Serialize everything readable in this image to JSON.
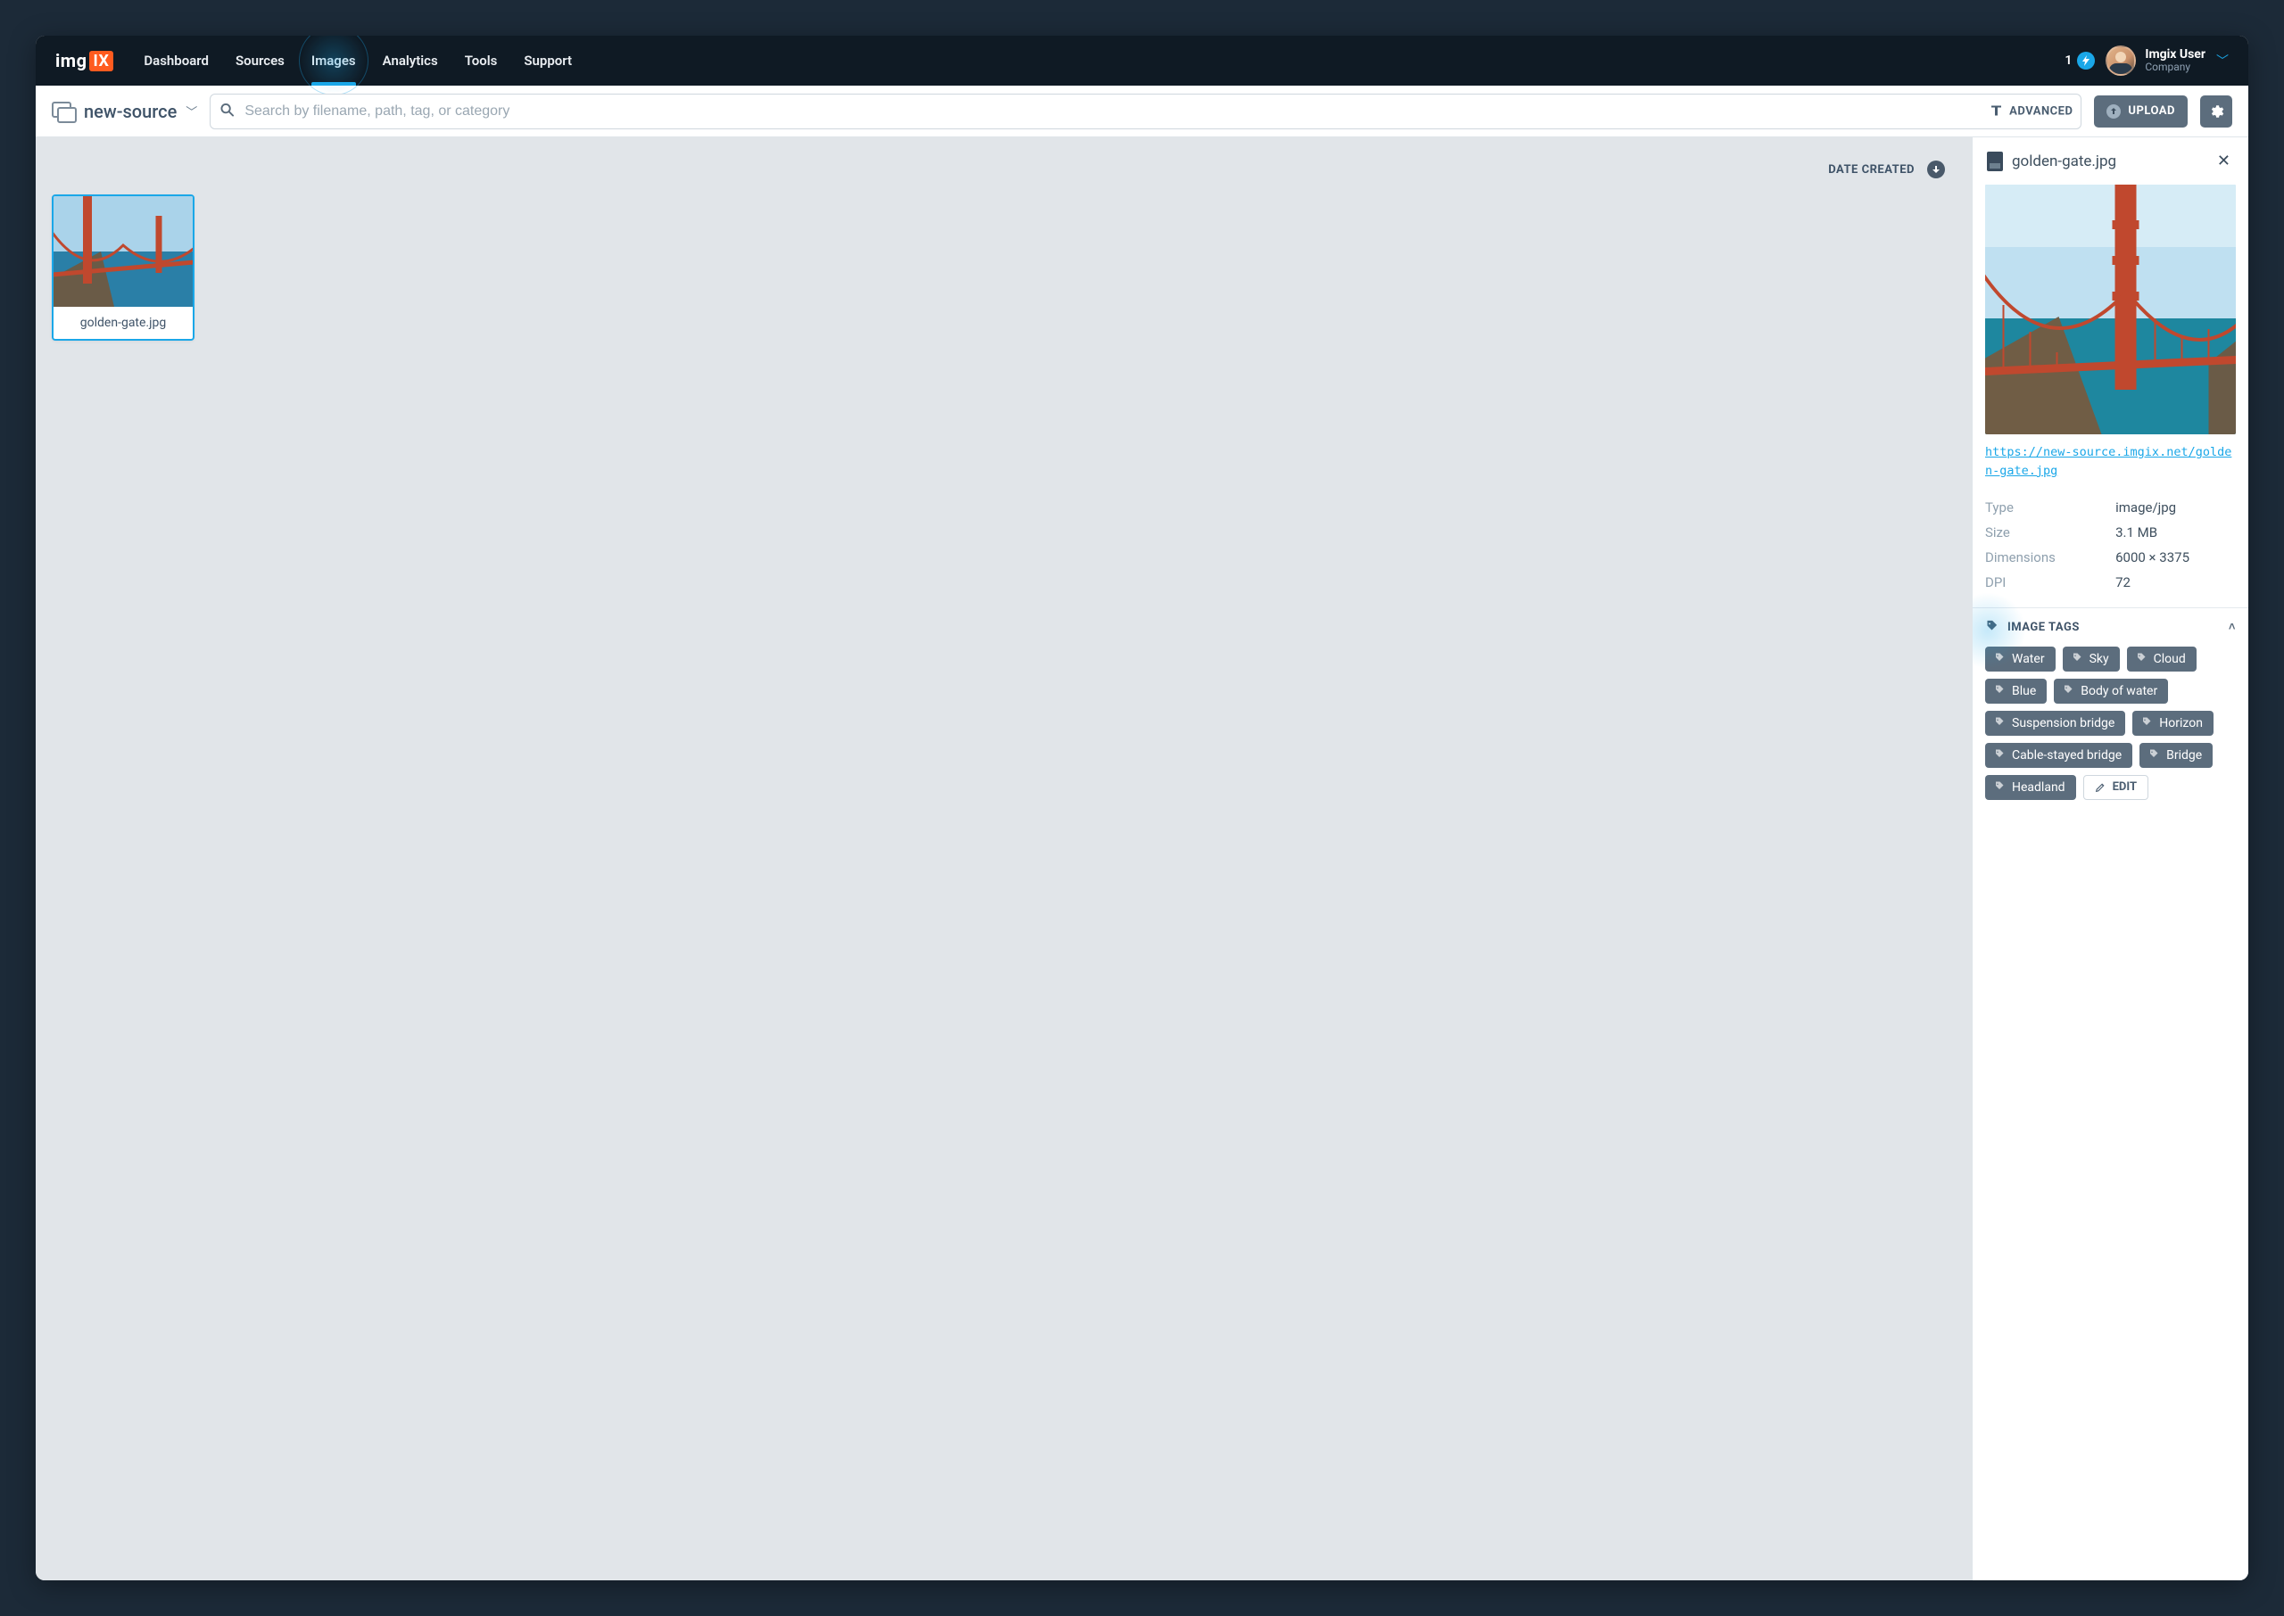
{
  "brand": {
    "logo_text": "img",
    "logo_box": "IX"
  },
  "nav": {
    "items": [
      {
        "label": "Dashboard",
        "active": false
      },
      {
        "label": "Sources",
        "active": false
      },
      {
        "label": "Images",
        "active": true
      },
      {
        "label": "Analytics",
        "active": false
      },
      {
        "label": "Tools",
        "active": false
      },
      {
        "label": "Support",
        "active": false
      }
    ]
  },
  "notifications": {
    "count": "1"
  },
  "user": {
    "name": "Imgix User",
    "company": "Company"
  },
  "source_selector": {
    "name": "new-source"
  },
  "search": {
    "placeholder": "Search by filename, path, tag, or category",
    "advanced_label": "ADVANCED"
  },
  "toolbar": {
    "upload_label": "UPLOAD"
  },
  "grid": {
    "sort_label": "DATE CREATED",
    "items": [
      {
        "filename": "golden-gate.jpg"
      }
    ]
  },
  "details": {
    "filename": "golden-gate.jpg",
    "url": "https://new-source.imgix.net/golden-gate.jpg",
    "meta": [
      {
        "k": "Type",
        "v": "image/jpg"
      },
      {
        "k": "Size",
        "v": "3.1 MB"
      },
      {
        "k": "Dimensions",
        "v": "6000 × 3375"
      },
      {
        "k": "DPI",
        "v": "72"
      }
    ],
    "tags_section": {
      "title": "IMAGE TAGS",
      "edit_label": "EDIT"
    },
    "tags": [
      "Water",
      "Sky",
      "Cloud",
      "Blue",
      "Body of water",
      "Suspension bridge",
      "Horizon",
      "Cable-stayed bridge",
      "Bridge",
      "Headland"
    ]
  }
}
